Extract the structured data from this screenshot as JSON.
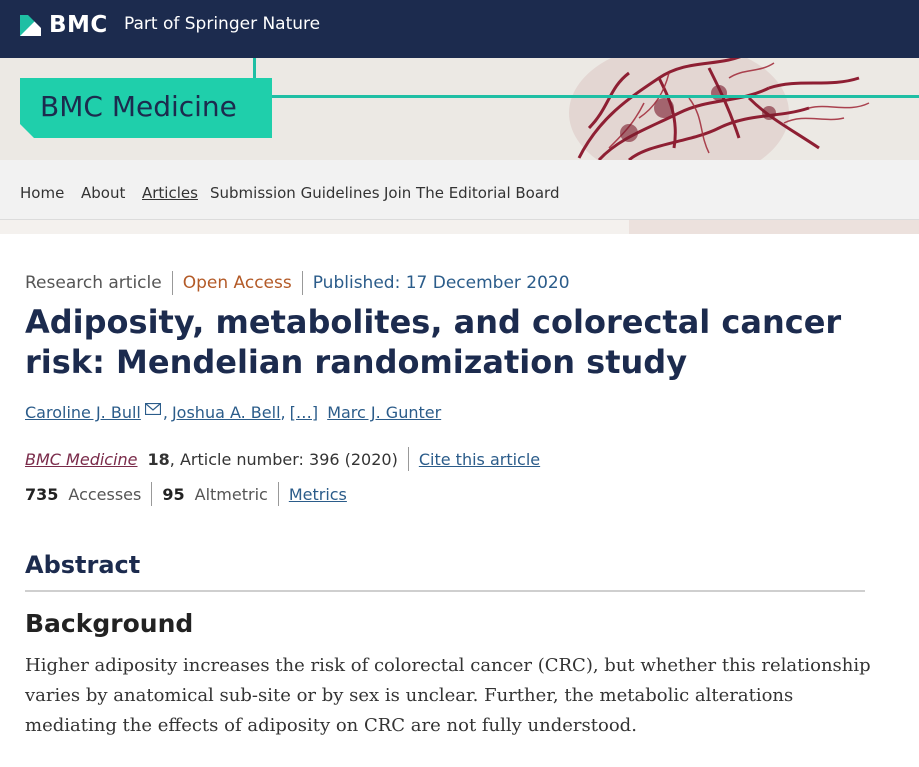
{
  "header": {
    "brand": "BMC",
    "tagline": "Part of Springer Nature"
  },
  "journal": {
    "name": "BMC Medicine"
  },
  "nav": {
    "items": [
      {
        "label": "Home"
      },
      {
        "label": "About"
      },
      {
        "label": "Articles",
        "active": true
      },
      {
        "label": "Submission Guidelines"
      },
      {
        "label": "Join The Editorial Board"
      }
    ]
  },
  "article": {
    "type": "Research article",
    "access": "Open Access",
    "published": "Published: 17 December 2020",
    "title": "Adiposity, metabolites, and colorectal cancer risk: Mendelian randomization study",
    "authors": [
      "Caroline J. Bull",
      "Joshua A. Bell",
      "[…]",
      "Marc J. Gunter"
    ],
    "citation": {
      "journal": "BMC Medicine",
      "volume": "18",
      "details": ", Article number: 396 (2020)",
      "cite_link": "Cite this article"
    },
    "metrics": {
      "accesses_count": "735",
      "accesses_label": "Accesses",
      "altmetric_count": "95",
      "altmetric_label": "Altmetric",
      "metrics_link": "Metrics"
    }
  },
  "abstract": {
    "heading": "Abstract",
    "section_heading": "Background",
    "section_text": "Higher adiposity increases the risk of colorectal cancer (CRC), but whether this relationship varies by anatomical sub-site or by sex is unclear. Further, the metabolic alterations mediating the effects of adiposity on CRC are not fully understood."
  },
  "icons": {
    "logo": "bmc-logo-icon",
    "mail": "envelope-icon"
  },
  "colors": {
    "header_bg": "#1c2b4e",
    "accent": "#1fcfab",
    "open_access": "#b35a27",
    "link": "#2b5c8a"
  }
}
